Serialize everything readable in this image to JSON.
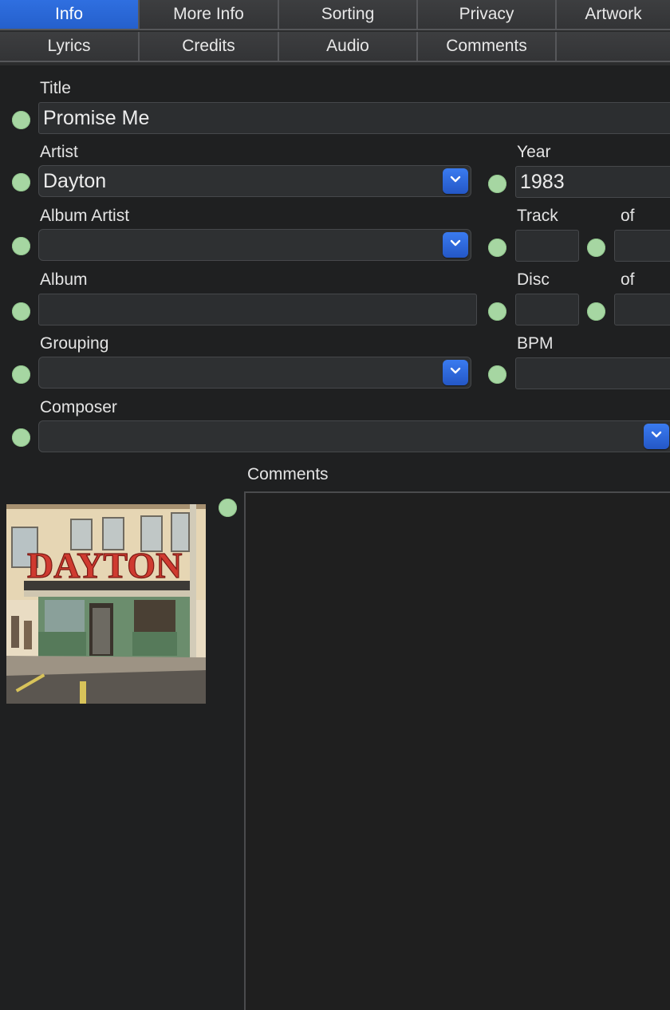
{
  "tabs": {
    "row1": [
      "Info",
      "More Info",
      "Sorting",
      "Privacy",
      "Artwork"
    ],
    "row2": [
      "Lyrics",
      "Credits",
      "Audio",
      "Comments"
    ],
    "active": "Info"
  },
  "fields": {
    "title": {
      "label": "Title",
      "value": "Promise Me"
    },
    "artist": {
      "label": "Artist",
      "value": "Dayton"
    },
    "year": {
      "label": "Year",
      "value": "1983"
    },
    "album_artist": {
      "label": "Album Artist",
      "value": ""
    },
    "track": {
      "label": "Track",
      "of_label": "of",
      "value": "",
      "of_value": ""
    },
    "album": {
      "label": "Album",
      "value": ""
    },
    "disc": {
      "label": "Disc",
      "of_label": "of",
      "value": "",
      "of_value": ""
    },
    "grouping": {
      "label": "Grouping",
      "value": ""
    },
    "bpm": {
      "label": "BPM",
      "value": ""
    },
    "composer": {
      "label": "Composer",
      "value": ""
    },
    "comments": {
      "label": "Comments",
      "value": ""
    }
  },
  "artwork": {
    "brand_text": "DAYTON",
    "icon": "album-artwork"
  },
  "colors": {
    "accent": "#2f6fe0",
    "indicator": "#a6d6a2",
    "background": "#1f2021"
  }
}
